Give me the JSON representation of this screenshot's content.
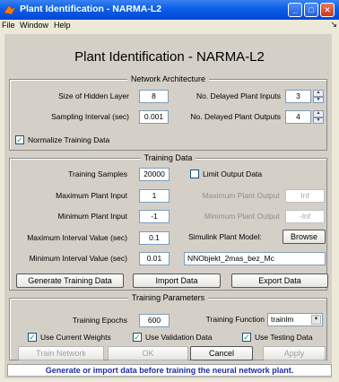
{
  "window": {
    "title": "Plant Identification - NARMA-L2",
    "minimize_glyph": "_",
    "maximize_glyph": "□",
    "close_glyph": "✕"
  },
  "menubar": {
    "items": [
      "File",
      "Window",
      "Help"
    ],
    "right_glyph": "↘"
  },
  "main_title": "Plant Identification - NARMA-L2",
  "network_architecture": {
    "title": "Network Architecture",
    "hidden_layer_label": "Size of Hidden Layer",
    "hidden_layer_value": "8",
    "delayed_inputs_label": "No. Delayed Plant Inputs",
    "delayed_inputs_value": "3",
    "sampling_label": "Sampling Interval (sec)",
    "sampling_value": "0.001",
    "delayed_outputs_label": "No. Delayed Plant Outputs",
    "delayed_outputs_value": "4",
    "normalize_label": "Normalize Training Data",
    "normalize_checked": true
  },
  "training_data": {
    "title": "Training Data",
    "samples_label": "Training Samples",
    "samples_value": "20000",
    "limit_output_label": "Limit Output Data",
    "limit_output_checked": false,
    "max_input_label": "Maximum Plant Input",
    "max_input_value": "1",
    "max_output_label": "Maximum Plant Output",
    "max_output_value": "Inf",
    "min_input_label": "Minimum Plant Input",
    "min_input_value": "-1",
    "min_output_label": "Minimum Plant Output",
    "min_output_value": "-Inf",
    "max_interval_label": "Maximum Interval Value (sec)",
    "max_interval_value": "0.1",
    "simulink_label": "Simulink Plant Model:",
    "browse_label": "Browse",
    "min_interval_label": "Minimum Interval Value (sec)",
    "min_interval_value": "0.01",
    "model_value": "NNObjekt_2mas_bez_Mc",
    "generate_label": "Generate Training Data",
    "import_label": "Import Data",
    "export_label": "Export Data"
  },
  "training_parameters": {
    "title": "Training Parameters",
    "epochs_label": "Training Epochs",
    "epochs_value": "600",
    "function_label": "Training Function",
    "function_value": "trainlm",
    "use_weights_label": "Use Current Weights",
    "use_weights_checked": true,
    "use_validation_label": "Use Validation Data",
    "use_validation_checked": true,
    "use_testing_label": "Use Testing Data",
    "use_testing_checked": true,
    "train_label": "Train Network",
    "ok_label": "OK",
    "cancel_label": "Cancel",
    "apply_label": "Apply"
  },
  "status_text": "Generate or import data before training the neural network plant.",
  "colors": {
    "titlebar": "#0a5fe5",
    "panel": "#d4d0c8",
    "status_text": "#1c2fa3",
    "check_mark": "#21a121"
  }
}
